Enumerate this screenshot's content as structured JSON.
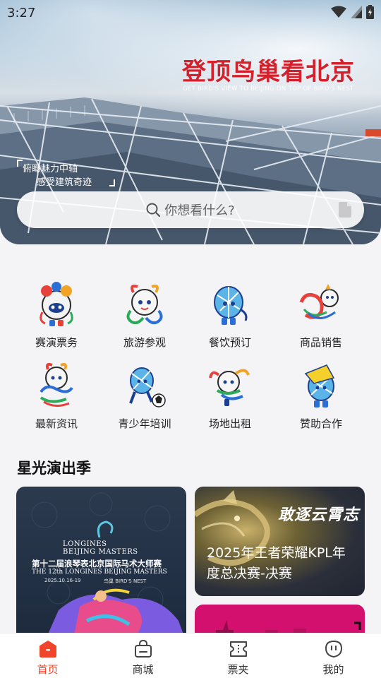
{
  "status_bar": {
    "time": "3:27"
  },
  "hero": {
    "title": "登顶鸟巢看北京",
    "subtitle": "GET BIRD'S VIEW TO BEIJING ON TOP OF BIRD'S NEST",
    "slogan_line1": "俯瞰魅力中轴",
    "slogan_line2": "感受建筑奇迹"
  },
  "search": {
    "placeholder": "你想看什么?"
  },
  "services": [
    {
      "label": "赛演票务"
    },
    {
      "label": "旅游参观"
    },
    {
      "label": "餐饮预订"
    },
    {
      "label": "商品销售"
    },
    {
      "label": "最新资讯"
    },
    {
      "label": "青少年培训"
    },
    {
      "label": "场地出租"
    },
    {
      "label": "赞助合作"
    }
  ],
  "section": {
    "title": "星光演出季"
  },
  "cards": {
    "left": {
      "logo_line1": "LONGINES",
      "logo_line2": "BEIJING MASTERS",
      "title": "第十二届浪琴表北京国际马术大师赛",
      "subtitle": "THE 12th LONGINES BEIJING MASTERS",
      "date": "2025.10.16-19",
      "venue": "鸟巢 BIRD'S NEST"
    },
    "right_top": {
      "slogan": "敢逐云霄志",
      "text": "2025年王者荣耀KPL年度总决赛-决赛"
    }
  },
  "bottom_nav": [
    {
      "label": "首页",
      "active": true
    },
    {
      "label": "商城",
      "active": false
    },
    {
      "label": "票夹",
      "active": false
    },
    {
      "label": "我的",
      "active": false
    }
  ],
  "colors": {
    "accent": "#f0452b",
    "hero_title": "#d5202c"
  }
}
